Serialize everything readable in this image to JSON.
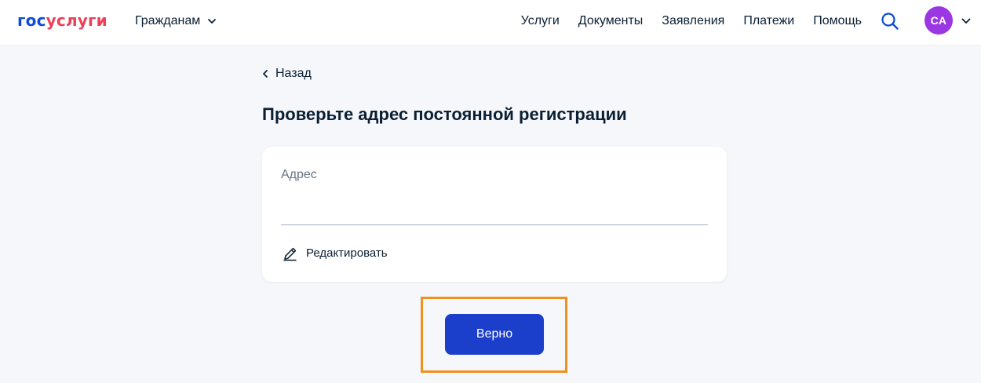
{
  "header": {
    "logo": {
      "part1": "гос",
      "part2": "услуги"
    },
    "audience_selector": "Гражданам",
    "nav": [
      "Услуги",
      "Документы",
      "Заявления",
      "Платежи",
      "Помощь"
    ],
    "avatar_initials": "СА",
    "icons": {
      "search": "search-icon",
      "audience_chevron": "chevron-down-icon",
      "avatar_chevron": "chevron-down-icon"
    }
  },
  "main": {
    "back_label": "Назад",
    "title": "Проверьте адрес постоянной регистрации",
    "card": {
      "field_label": "Адрес",
      "address_value": "",
      "edit_label": "Редактировать"
    },
    "confirm_label": "Верно"
  },
  "colors": {
    "brand_blue": "#0d4cd3",
    "brand_red": "#ee3f58",
    "button_blue": "#1c3fcb",
    "avatar_purple": "#9b36e3",
    "highlight_orange": "#f0901e",
    "background": "#f5f7fb"
  }
}
